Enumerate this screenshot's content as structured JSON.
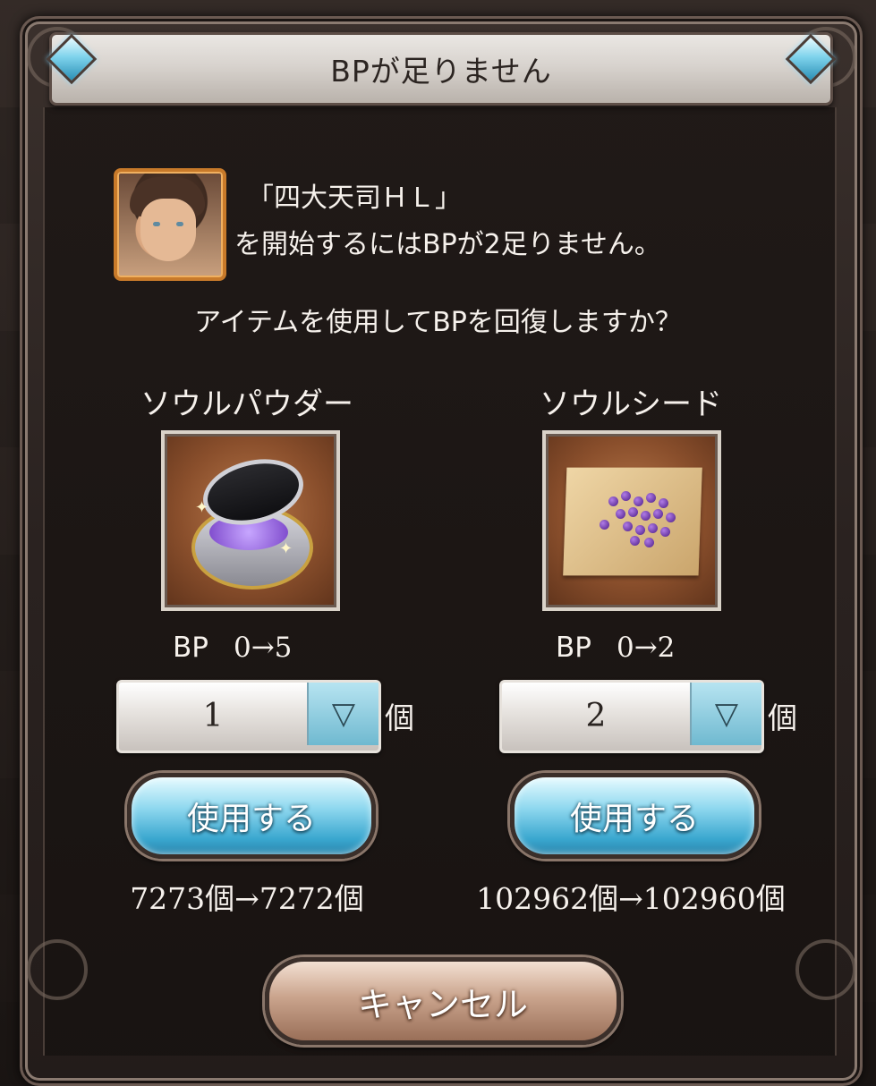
{
  "dialog": {
    "title": "BPが足りません",
    "message_line1": "「四大天司ＨＬ」",
    "message_line2": "を開始するにはBPが2足りません。",
    "question": "アイテムを使用してBPを回復しますか？",
    "cancel_label": "キャンセル"
  },
  "items": [
    {
      "name": "ソウルパウダー",
      "icon": "soul-powder-icon",
      "bp_label": "BP",
      "bp_change": "0→5",
      "quantity": "1",
      "unit": "個",
      "use_label": "使用する",
      "count_change": "7273個→7272個"
    },
    {
      "name": "ソウルシード",
      "icon": "soul-seed-icon",
      "bp_label": "BP",
      "bp_change": "0→2",
      "quantity": "2",
      "unit": "個",
      "use_label": "使用する",
      "count_change": "102962個→102960個"
    }
  ],
  "colors": {
    "use_button": "#3aa7cf",
    "cancel_button": "#9a6f58",
    "title_bar": "#d8d3ce",
    "portrait_frame": "#c87a2a"
  }
}
